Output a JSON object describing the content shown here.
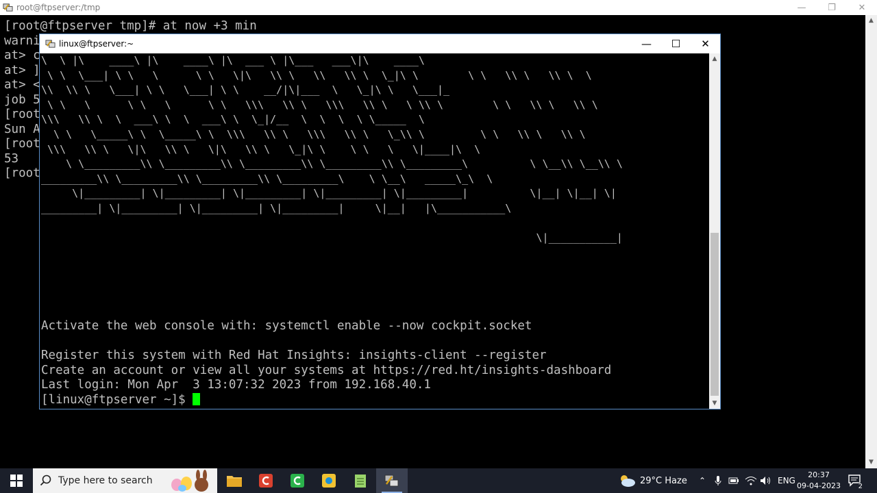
{
  "back_window": {
    "title": "root@ftpserver:/tmp",
    "lines": [
      "[root@ftpserver tmp]# at now +3 min",
      "warni",
      "at> c",
      "at> ]",
      "at> <",
      "job 5",
      "[root",
      "Sun A",
      "[root",
      "53",
      "[root"
    ]
  },
  "front_window": {
    "title": "linux@ftpserver:~",
    "banner": [
      "\\  \\ |\\    ____\\ |\\    ____\\ |\\  ___ \\ |\\___   ___\\|\\    ____\\",
      " \\ \\  \\___| \\ \\   \\      \\ \\   \\|\\   \\\\ \\   \\\\   \\\\ \\  \\_|\\ \\        \\ \\   \\\\ \\   \\\\ \\  \\",
      "\\\\  \\\\ \\   \\___| \\ \\   \\___| \\ \\    __/|\\|___  \\   \\_|\\ \\   \\___|_",
      " \\ \\   \\      \\ \\   \\      \\ \\   \\\\\\   \\\\ \\   \\\\\\   \\\\ \\   \\ \\\\ \\        \\ \\   \\\\ \\   \\\\ \\",
      "\\\\\\   \\\\ \\  \\  ___\\ \\  \\  ___\\ \\  \\_|/__  \\  \\  \\  \\ \\_____  \\",
      "  \\ \\   \\_____\\ \\  \\_____\\ \\  \\\\\\   \\\\ \\   \\\\\\   \\\\ \\   \\_\\\\ \\         \\ \\   \\\\ \\   \\\\ \\",
      " \\\\\\   \\\\ \\   \\|\\   \\\\ \\   \\|\\   \\\\ \\   \\_|\\ \\    \\ \\   \\   \\|____|\\  \\",
      "    \\ \\_________\\\\ \\_________\\\\ \\_________\\\\ \\_________\\\\ \\_________\\          \\ \\__\\\\ \\__\\\\ \\",
      "_________\\\\ \\_________\\\\ \\_________\\\\ \\_________\\    \\ \\__\\   _____\\_\\  \\",
      "     \\|_________| \\|_________| \\|_________| \\|_________| \\|_________|          \\|__| \\|__| \\|",
      "_________| \\|_________| \\|_________| \\|_________|     \\|__|   |\\___________\\",
      "",
      "                                                                                \\|___________|"
    ],
    "messages": [
      "Activate the web console with: systemctl enable --now cockpit.socket",
      "",
      "Register this system with Red Hat Insights: insights-client --register",
      "Create an account or view all your systems at https://red.ht/insights-dashboard",
      "Last login: Mon Apr  3 13:07:32 2023 from 192.168.40.1"
    ],
    "prompt": "[linux@ftpserver ~]$ "
  },
  "taskbar": {
    "search_placeholder": "Type here to search",
    "weather": "29°C  Haze",
    "language": "ENG",
    "time": "20:37",
    "date": "09-04-2023",
    "notification_count": "2"
  },
  "colors": {
    "terminal_text": "#c0c0c0",
    "cursor": "#00ff00",
    "taskbar_bg": "#1b1f2a"
  }
}
